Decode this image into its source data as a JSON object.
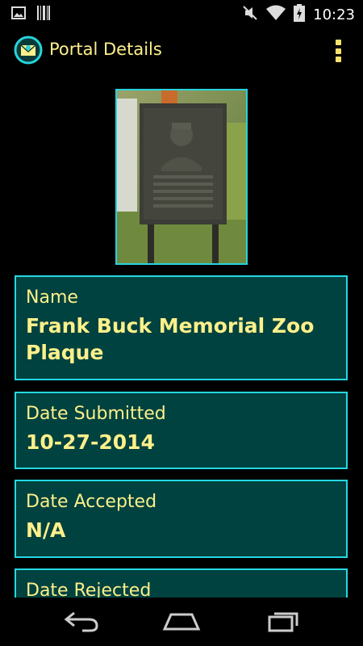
{
  "status_bar": {
    "time": "10:23",
    "left_icons": [
      "image-icon",
      "barcode-icon"
    ],
    "right_icons": [
      "mute-icon",
      "wifi-icon",
      "battery-icon"
    ]
  },
  "action_bar": {
    "title": "Portal Details",
    "app_icon": "envelope-portal-icon",
    "menu_icon": "overflow-menu-icon"
  },
  "portal": {
    "photo_description_icon": "portal-photo",
    "fields": [
      {
        "label": "Name",
        "value": "Frank Buck Memorial Zoo Plaque"
      },
      {
        "label": "Date Submitted",
        "value": "10-27-2014"
      },
      {
        "label": "Date Accepted",
        "value": "N/A"
      },
      {
        "label": "Date Rejected",
        "value": ""
      }
    ]
  },
  "nav_bar": {
    "back": "back-icon",
    "home": "home-icon",
    "recents": "recents-icon"
  },
  "colors": {
    "accent": "#25d8e3",
    "card_bg": "#00423f",
    "text": "#fdf08a"
  }
}
